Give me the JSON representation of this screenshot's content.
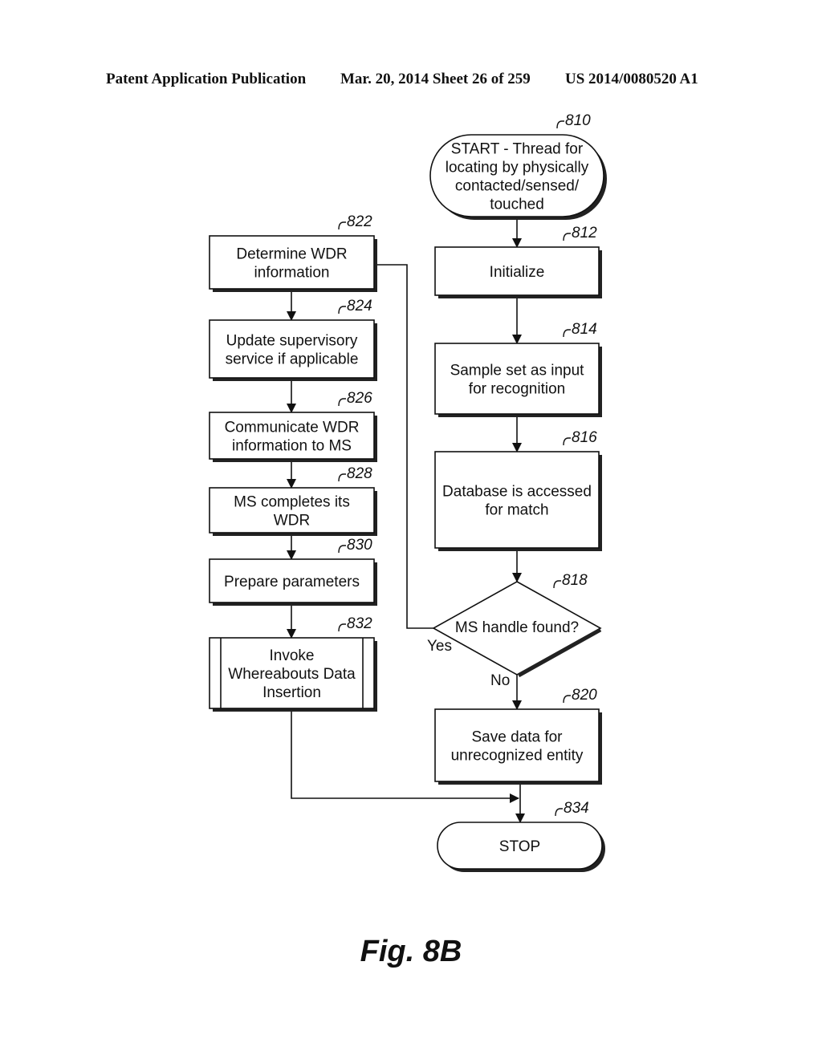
{
  "header": {
    "publication": "Patent Application Publication",
    "date_sheet": "Mar. 20, 2014  Sheet 26 of 259",
    "patent_number": "US 2014/0080520 A1"
  },
  "figure_caption": "Fig. 8B",
  "nodes": {
    "n810": {
      "ref": "810",
      "shape": "terminator",
      "lines": [
        "START - Thread for",
        "locating by physically",
        "contacted/sensed/",
        "touched"
      ]
    },
    "n812": {
      "ref": "812",
      "shape": "process",
      "lines": [
        "Initialize"
      ]
    },
    "n814": {
      "ref": "814",
      "shape": "process",
      "lines": [
        "Sample set as input",
        "for recognition"
      ]
    },
    "n816": {
      "ref": "816",
      "shape": "process",
      "lines": [
        "Database is accessed",
        "for match"
      ]
    },
    "n818": {
      "ref": "818",
      "shape": "decision",
      "lines": [
        "MS handle found?"
      ]
    },
    "n820": {
      "ref": "820",
      "shape": "process",
      "lines": [
        "Save data for",
        "unrecognized entity"
      ]
    },
    "n822": {
      "ref": "822",
      "shape": "process",
      "lines": [
        "Determine WDR",
        "information"
      ]
    },
    "n824": {
      "ref": "824",
      "shape": "process",
      "lines": [
        "Update supervisory",
        "service if applicable"
      ]
    },
    "n826": {
      "ref": "826",
      "shape": "process",
      "lines": [
        "Communicate WDR",
        "information to MS"
      ]
    },
    "n828": {
      "ref": "828",
      "shape": "process",
      "lines": [
        "MS completes its",
        "WDR"
      ]
    },
    "n830": {
      "ref": "830",
      "shape": "process",
      "lines": [
        "Prepare parameters"
      ]
    },
    "n832": {
      "ref": "832",
      "shape": "predefined-process",
      "lines": [
        "Invoke",
        "Whereabouts Data",
        "Insertion"
      ]
    },
    "n834": {
      "ref": "834",
      "shape": "terminator",
      "lines": [
        "STOP"
      ]
    }
  },
  "edges": [
    {
      "from": "810",
      "to": "812",
      "label": ""
    },
    {
      "from": "812",
      "to": "814",
      "label": ""
    },
    {
      "from": "814",
      "to": "816",
      "label": ""
    },
    {
      "from": "816",
      "to": "818",
      "label": ""
    },
    {
      "from": "818",
      "to": "822",
      "label": "Yes"
    },
    {
      "from": "818",
      "to": "820",
      "label": "No"
    },
    {
      "from": "822",
      "to": "824",
      "label": ""
    },
    {
      "from": "824",
      "to": "826",
      "label": ""
    },
    {
      "from": "826",
      "to": "828",
      "label": ""
    },
    {
      "from": "828",
      "to": "830",
      "label": ""
    },
    {
      "from": "830",
      "to": "832",
      "label": ""
    },
    {
      "from": "832",
      "to": "834",
      "label": ""
    },
    {
      "from": "820",
      "to": "834",
      "label": ""
    }
  ]
}
